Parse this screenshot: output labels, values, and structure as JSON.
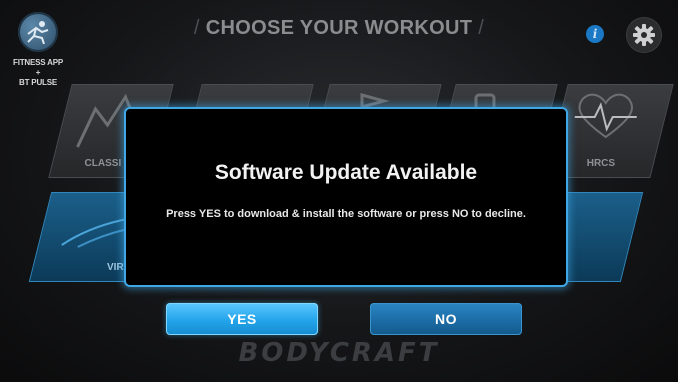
{
  "header": {
    "title": "CHOOSE YOUR WORKOUT",
    "app_label": "FITNESS APP\n+\nBT PULSE",
    "info_glyph": "i"
  },
  "tiles": {
    "top_row": [
      "CLASSI",
      "",
      "",
      "",
      "HRCS"
    ],
    "bottom_row": [
      "VIRT",
      ""
    ]
  },
  "dialog": {
    "title": "Software Update Available",
    "message": "Press YES to download & install the software or press NO to decline."
  },
  "buttons": {
    "yes": "YES",
    "no": "NO"
  },
  "brand": "BODYCRAFT",
  "colors": {
    "accent": "#3fa7e6",
    "yes_button": "#23a4ea",
    "no_button": "#1b6aa4",
    "background": "#151618"
  },
  "icons": {
    "app": "runner-icon",
    "info": "info-icon",
    "settings": "gear-icon"
  }
}
